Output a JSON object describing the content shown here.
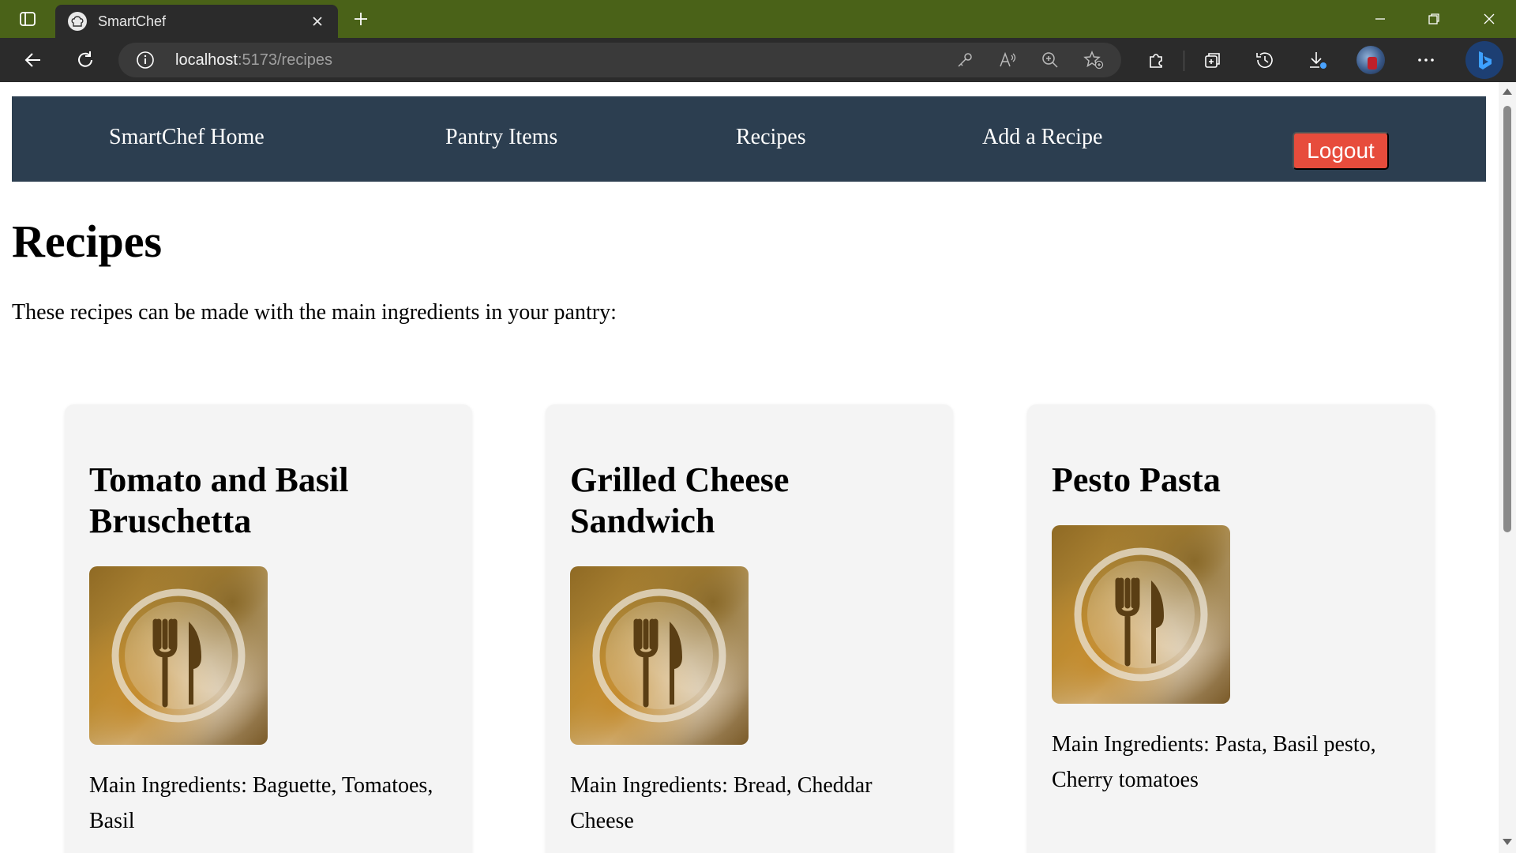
{
  "browser": {
    "tab_title": "SmartChef",
    "url_host": "localhost",
    "url_path": ":5173/recipes"
  },
  "nav": {
    "home": "SmartChef Home",
    "pantry": "Pantry Items",
    "recipes": "Recipes",
    "add_recipe": "Add a Recipe",
    "logout": "Logout"
  },
  "page": {
    "title": "Recipes",
    "intro": "These recipes can be made with the main ingredients in your pantry:"
  },
  "recipes": [
    {
      "title": "Tomato and Basil Bruschetta",
      "ingredients": "Main Ingredients: Baguette, Tomatoes, Basil"
    },
    {
      "title": "Grilled Cheese Sandwich",
      "ingredients": "Main Ingredients: Bread, Cheddar Cheese"
    },
    {
      "title": "Pesto Pasta",
      "ingredients": "Main Ingredients: Pasta, Basil pesto, Cherry tomatoes"
    }
  ],
  "colors": {
    "titlebar": "#4a6218",
    "navbar": "#2c3e50",
    "logout": "#e74c3c",
    "card": "#f4f4f4"
  }
}
